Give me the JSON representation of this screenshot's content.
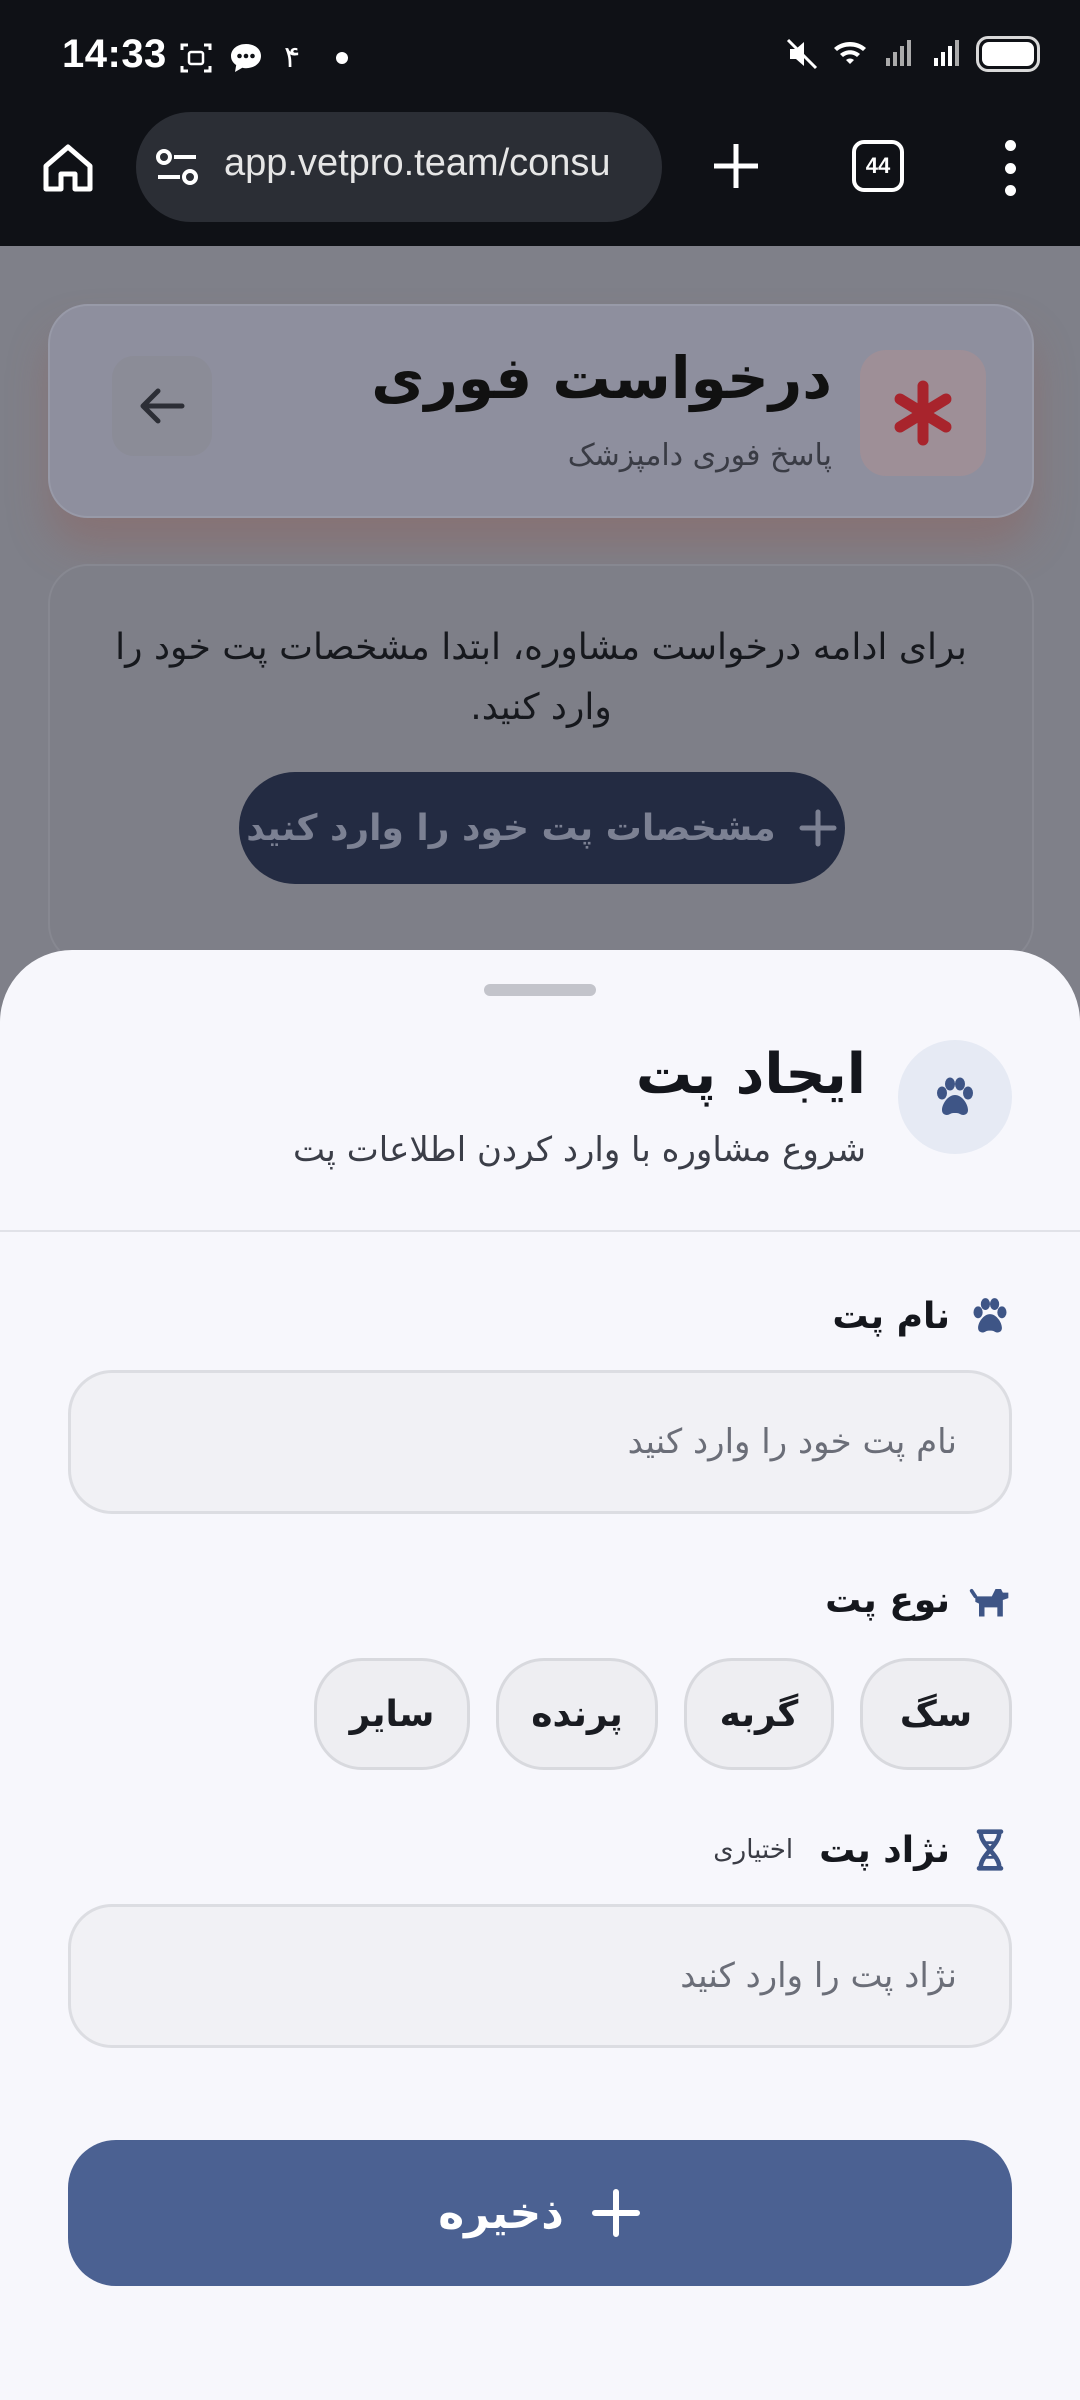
{
  "status_bar": {
    "time": "14:33",
    "notification_digit": "۴"
  },
  "browser": {
    "url": "app.vetpro.team/consu",
    "tab_count": "44"
  },
  "urgent_card": {
    "title": "درخواست فوری",
    "subtitle": "پاسخ فوری دامپزشک"
  },
  "notice": {
    "text": "برای ادامه درخواست مشاوره، ابتدا مشخصات پت خود را وارد کنید.",
    "button_label": "مشخصات پت خود را وارد کنید"
  },
  "sheet": {
    "title": "ایجاد پت",
    "subtitle": "شروع مشاوره با وارد کردن اطلاعات پت",
    "pet_name": {
      "label": "نام پت",
      "placeholder": "نام پت خود را وارد کنید",
      "value": ""
    },
    "pet_type": {
      "label": "نوع پت",
      "options": [
        "سگ",
        "گربه",
        "پرنده",
        "سایر"
      ]
    },
    "pet_breed": {
      "label": "نژاد پت",
      "optional_tag": "اختیاری",
      "placeholder": "نژاد پت را وارد کنید",
      "value": ""
    },
    "save_label": "ذخیره"
  },
  "colors": {
    "primary": "#4b6192",
    "urgent_red": "#c8242f",
    "sheet_bg": "#f7f7fc",
    "scrim_page": "#7f8089"
  }
}
